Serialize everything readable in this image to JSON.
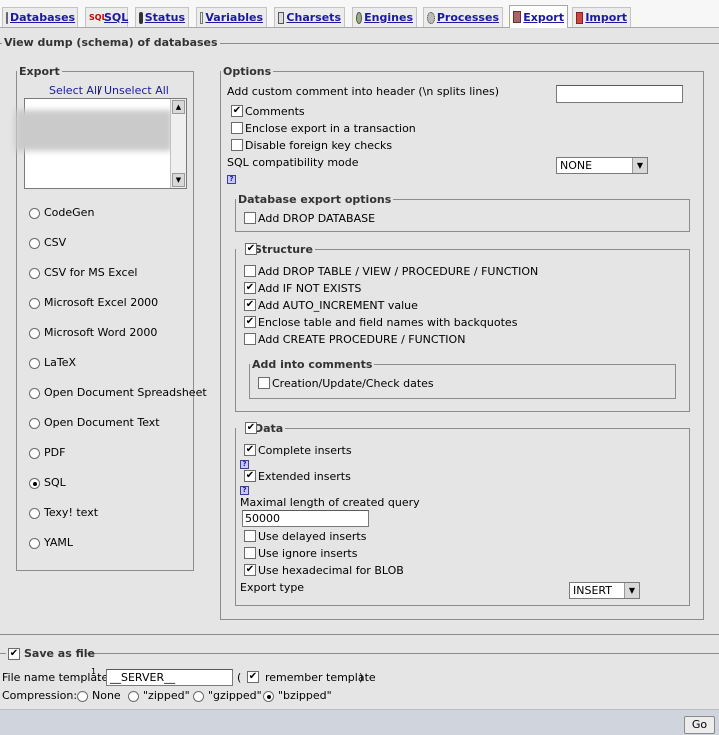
{
  "tabs": [
    {
      "label": "Databases",
      "icon": "database-icon"
    },
    {
      "label": "SQL",
      "icon": "sql-icon"
    },
    {
      "label": "Status",
      "icon": "status-icon"
    },
    {
      "label": "Variables",
      "icon": "variables-icon"
    },
    {
      "label": "Charsets",
      "icon": "charsets-icon"
    },
    {
      "label": "Engines",
      "icon": "engines-icon"
    },
    {
      "label": "Processes",
      "icon": "processes-icon"
    },
    {
      "label": "Export",
      "icon": "export-icon",
      "active": true
    },
    {
      "label": "Import",
      "icon": "import-icon"
    }
  ],
  "main_legend": "View dump (schema) of databases",
  "export": {
    "legend": "Export",
    "select_all": "Select All",
    "separator": "/",
    "unselect_all": "Unselect All",
    "formats": [
      "CodeGen",
      "CSV",
      "CSV for MS Excel",
      "Microsoft Excel 2000",
      "Microsoft Word 2000",
      "LaTeX",
      "Open Document Spreadsheet",
      "Open Document Text",
      "PDF",
      "SQL",
      "Texy! text",
      "YAML"
    ],
    "selected_format": "SQL"
  },
  "options": {
    "legend": "Options",
    "custom_comment_label": "Add custom comment into header (\\n splits lines)",
    "custom_comment_value": "",
    "comments": {
      "label": "Comments",
      "checked": true
    },
    "transaction": {
      "label": "Enclose export in a transaction",
      "checked": false
    },
    "foreign_keys": {
      "label": "Disable foreign key checks",
      "checked": false
    },
    "compat_label": "SQL compatibility mode",
    "compat_value": "NONE",
    "db_export": {
      "legend": "Database export options",
      "drop_database": {
        "label": "Add DROP DATABASE",
        "checked": false
      }
    },
    "structure": {
      "legend": "Structure",
      "checked": true,
      "drop_table": {
        "label": "Add DROP TABLE / VIEW / PROCEDURE / FUNCTION",
        "checked": false
      },
      "if_not_exists": {
        "label": "Add IF NOT EXISTS",
        "checked": true
      },
      "auto_increment": {
        "label": "Add AUTO_INCREMENT value",
        "checked": true
      },
      "backquotes": {
        "label": "Enclose table and field names with backquotes",
        "checked": true
      },
      "create_procedure": {
        "label": "Add CREATE PROCEDURE / FUNCTION",
        "checked": false
      },
      "comments_legend": "Add into comments",
      "dates": {
        "label": "Creation/Update/Check dates",
        "checked": false
      }
    },
    "data": {
      "legend": "Data",
      "checked": true,
      "complete_inserts": {
        "label": "Complete inserts",
        "checked": true
      },
      "extended_inserts": {
        "label": "Extended inserts",
        "checked": true
      },
      "max_query_label": "Maximal length of created query",
      "max_query_value": "50000",
      "delayed_inserts": {
        "label": "Use delayed inserts",
        "checked": false
      },
      "ignore_inserts": {
        "label": "Use ignore inserts",
        "checked": false
      },
      "hex_blob": {
        "label": "Use hexadecimal for BLOB",
        "checked": true
      },
      "export_type_label": "Export type",
      "export_type_value": "INSERT"
    }
  },
  "save": {
    "legend": "Save as file",
    "checked": true,
    "template_label": "File name template",
    "template_sup": "1",
    "template_colon": ":",
    "template_value": "__SERVER__",
    "remember_open": "(",
    "remember_label": "remember template",
    "remember_close": ")",
    "remember_checked": true,
    "compression_label": "Compression:",
    "compression_options": [
      "None",
      "\"zipped\"",
      "\"gzipped\"",
      "\"bzipped\""
    ],
    "compression_selected": "\"bzipped\""
  },
  "go_label": "Go",
  "help_glyph": "?",
  "check_glyph": "✔",
  "arrow_glyph": "▼"
}
